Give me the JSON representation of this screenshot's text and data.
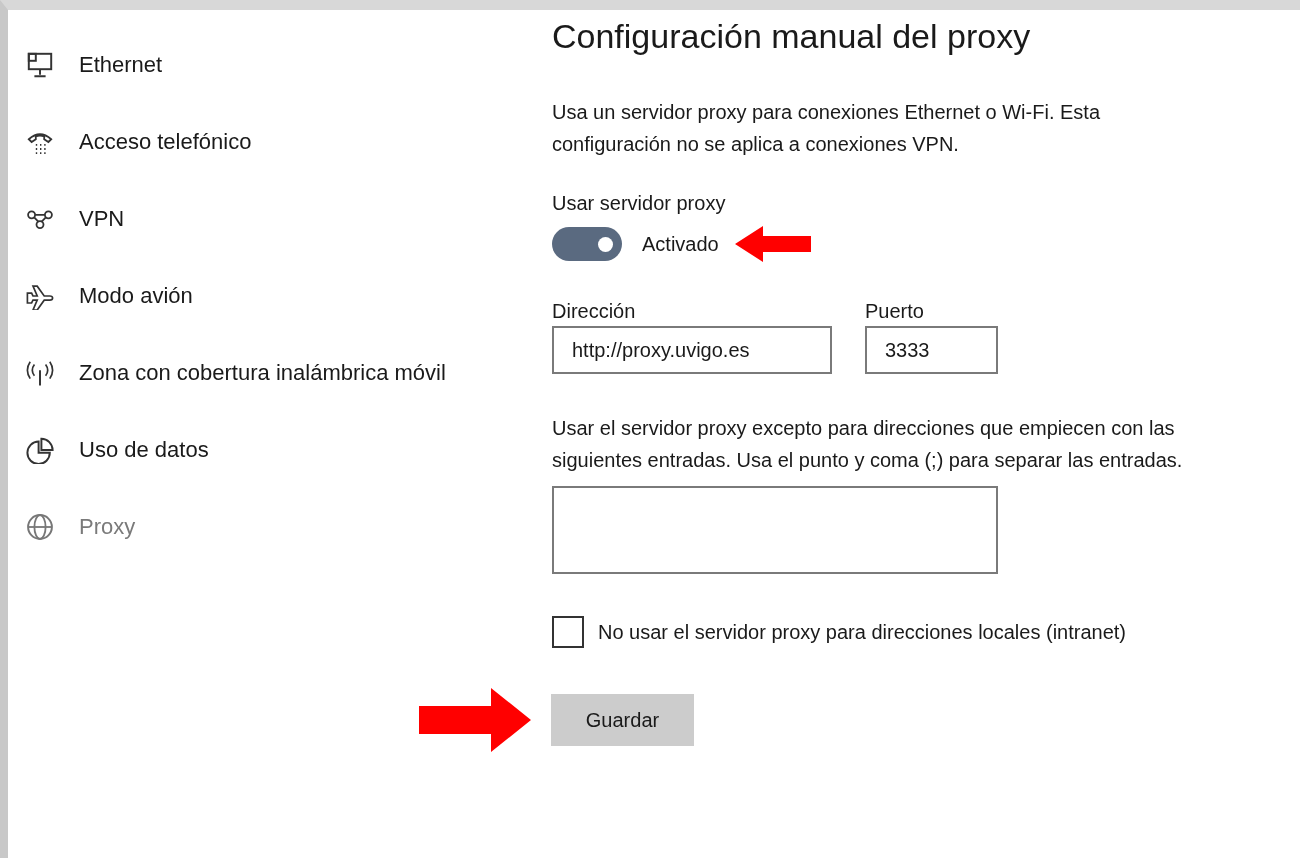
{
  "sidebar": {
    "items": [
      {
        "label": "Ethernet",
        "selected": false
      },
      {
        "label": "Acceso telefónico",
        "selected": false
      },
      {
        "label": "VPN",
        "selected": false
      },
      {
        "label": "Modo avión",
        "selected": false
      },
      {
        "label": "Zona con cobertura inalámbrica móvil",
        "selected": false
      },
      {
        "label": "Uso de datos",
        "selected": false
      },
      {
        "label": "Proxy",
        "selected": true
      }
    ]
  },
  "section": {
    "title": "Configuración manual del proxy",
    "description": "Usa un servidor proxy para conexiones Ethernet o Wi-Fi. Esta configuración no se aplica a conexiones VPN.",
    "proxy_toggle": {
      "label": "Usar servidor proxy",
      "on": true,
      "state_text": "Activado"
    },
    "address": {
      "label": "Dirección",
      "value": "http://proxy.uvigo.es"
    },
    "port": {
      "label": "Puerto",
      "value": "3333"
    },
    "exceptions": {
      "description": "Usar el servidor proxy excepto para direcciones que empiecen con las siguientes entradas. Usa el punto y coma (;) para separar las entradas."
    },
    "local_bypass": {
      "label": "No usar el servidor proxy para direcciones locales (intranet)",
      "checked": false
    },
    "save_button": "Guardar"
  }
}
